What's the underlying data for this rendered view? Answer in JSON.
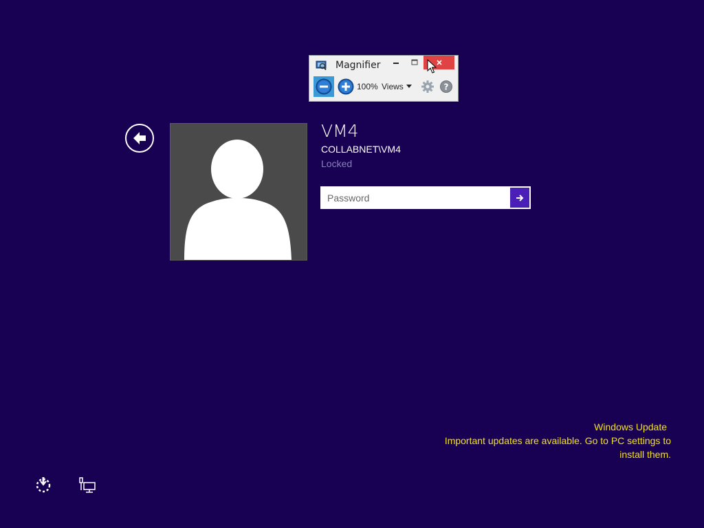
{
  "magnifier": {
    "title": "Magnifier",
    "zoom_level": "100%",
    "views_label": "Views",
    "icons": {
      "app": "magnifier-app-icon",
      "minimize": "minimize-icon",
      "maximize": "maximize-icon",
      "close": "close-icon",
      "zoom_out": "zoom-out-icon",
      "zoom_in": "zoom-in-icon",
      "settings": "gear-icon",
      "help": "help-icon"
    }
  },
  "login": {
    "user_name": "VM4",
    "account": "COLLABNET\\VM4",
    "status": "Locked",
    "password_placeholder": "Password"
  },
  "update": {
    "title": "Windows Update",
    "message_line1": "Important updates are available. Go to PC settings to",
    "message_line2": "install them."
  },
  "icons": {
    "back": "back-arrow-icon",
    "submit": "arrow-right-icon",
    "ease_of_access": "ease-of-access-icon",
    "network": "network-icon"
  },
  "colors": {
    "background": "#180052",
    "accent": "#4a1fb8",
    "update_text": "#f2e21f",
    "status_text": "#8a82c0"
  }
}
